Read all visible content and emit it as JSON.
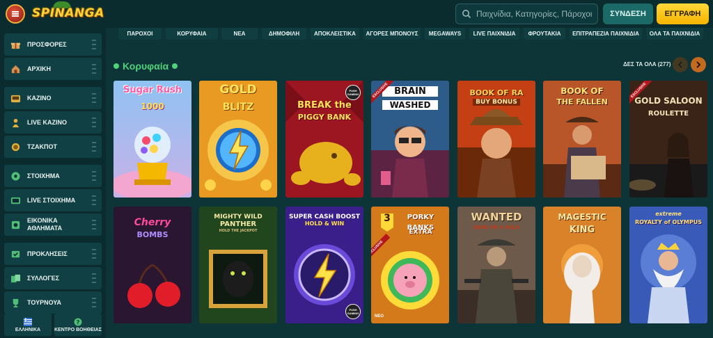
{
  "header": {
    "logo_text": "SPINANGA",
    "search_placeholder": "Παιχνίδια, Κατηγορίες, Πάροχοι",
    "login_label": "ΣΥΝΔΕΣΗ",
    "register_label": "ΕΓΓΡΑΦΗ",
    "colors": {
      "accent_yellow": "#f5b400",
      "teal_button": "#1c6a67"
    }
  },
  "sidebar": {
    "items": [
      {
        "label": "ΠΡΟΣΦΟΡΕΣ",
        "icon": "gift-icon"
      },
      {
        "label": "ΑΡΧΙΚΗ",
        "icon": "home-icon"
      },
      {
        "label": "ΚΑΖΙΝΟ",
        "icon": "casino-icon"
      },
      {
        "label": "LIVE ΚΑΖΙΝΟ",
        "icon": "dealer-icon"
      },
      {
        "label": "ΤΖΑΚΠΟΤ",
        "icon": "jackpot-icon"
      },
      {
        "label": "ΣΤΟΙΧΗΜΑ",
        "icon": "football-icon"
      },
      {
        "label": "LIVE ΣΤΟΙΧΗΜΑ",
        "icon": "live-tv-icon"
      },
      {
        "label": "ΕΙΚΟΝΙΚΑ ΑΘΛΗΜΑΤΑ",
        "icon": "virtual-sports-icon"
      },
      {
        "label": "ΠΡΟΚΛΗΣΕΙΣ",
        "icon": "challenge-icon"
      },
      {
        "label": "ΣΥΛΛΟΓΕΣ",
        "icon": "collections-icon"
      },
      {
        "label": "ΤΟΥΡΝΟΥΑ",
        "icon": "trophy-icon"
      }
    ],
    "language_label": "ΕΛΛΗΝΙΚΑ",
    "help_label": "ΚΕΝΤΡΟ ΒΟΗΘΕΙΑΣ"
  },
  "categories": [
    "ΠΑΡΟΧΟΙ",
    "ΚΟΡΥΦΑΙΑ",
    "ΝΕΑ",
    "ΔΗΜΟΦΙΛΗ",
    "ΑΠΟΚΛΕΙΣΤΙΚΑ",
    "ΑΓΟΡΕΣ ΜΠΟΝΟΥΣ",
    "MEGAWAYS",
    "LIVE ΠΑΙΧΝΙΔΙΑ",
    "ΦΡΟΥΤΑΚΙΑ",
    "ΕΠΙΤΡΑΠΕΖΙΑ ΠΑΙΧΝΙΔΙΑ",
    "ΟΛΑ ΤΑ ΠΑΙΧΝΙΔΙΑ"
  ],
  "section": {
    "title": "Κορυφαία",
    "see_all": "ΔΕΣ ΤΑ ΟΛΑ (277)"
  },
  "games": [
    {
      "title": "Sugar Rush",
      "subtitle": "1000",
      "badge": ""
    },
    {
      "title": "GOLD",
      "subtitle": "BLITZ",
      "badge": ""
    },
    {
      "title": "BREAK the",
      "subtitle": "PIGGY BANK",
      "badge": "",
      "provider": "PUSH GAMING"
    },
    {
      "title": "BRAIN",
      "subtitle": "WASHED",
      "badge": "EXCLUSIVE"
    },
    {
      "title": "BOOK OF RA",
      "subtitle": "BUY BONUS",
      "badge": ""
    },
    {
      "title": "BOOK OF",
      "subtitle": "THE FALLEN",
      "badge": ""
    },
    {
      "title": "GOLD SALOON",
      "subtitle": "ROULETTE",
      "badge": "EXCLUSIVE"
    },
    {
      "title": "Cherry",
      "subtitle": "BOMBS",
      "badge": ""
    },
    {
      "title": "MIGHTY WILD",
      "subtitle": "PANTHER",
      "badge": "",
      "tagline": "HOLD THE JACKPOT"
    },
    {
      "title": "SUPER CASH BOOST",
      "subtitle": "HOLD & WIN",
      "badge": "",
      "provider": "PUSH GAMING"
    },
    {
      "title": "PORKY BANKS",
      "subtitle": "EXTRA",
      "badge": "EXCLUSIVE",
      "number": "3",
      "provider": "NEO"
    },
    {
      "title": "WANTED",
      "subtitle": "DEAD OR A WILD",
      "badge": ""
    },
    {
      "title": "MAGESTIC",
      "subtitle": "KING",
      "badge": ""
    },
    {
      "title": "extreme",
      "subtitle": "ROYALTY of OLYMPUS",
      "badge": ""
    }
  ]
}
